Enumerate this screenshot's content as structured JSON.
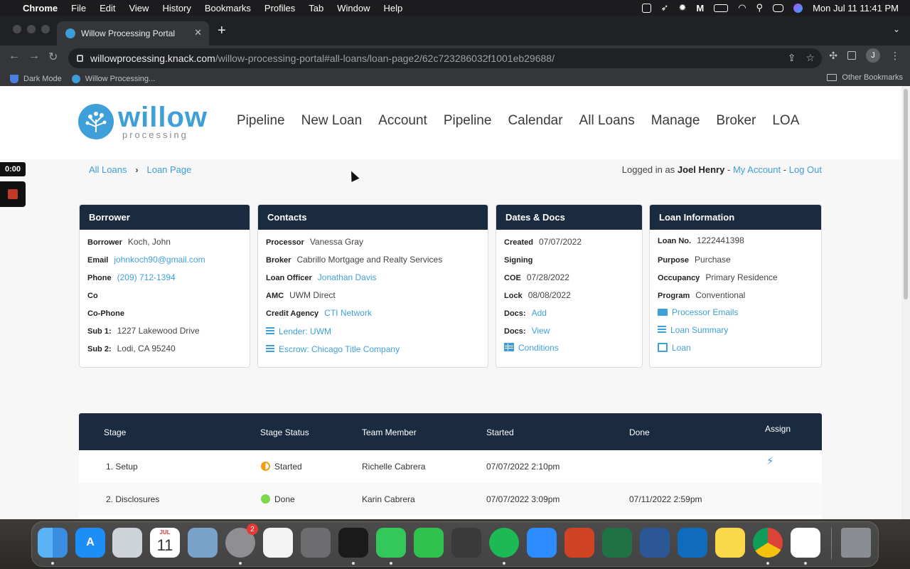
{
  "menubar": {
    "app": "Chrome",
    "items": [
      "File",
      "Edit",
      "View",
      "History",
      "Bookmarks",
      "Profiles",
      "Tab",
      "Window",
      "Help"
    ],
    "datetime": "Mon Jul 11  11:41 PM"
  },
  "browser": {
    "tab_title": "Willow Processing Portal",
    "url_host": "willowprocessing.knack.com",
    "url_path": "/willow-processing-portal#all-loans/loan-page2/62c723286032f1001eb29688/",
    "profile_initial": "J",
    "bookmarks": [
      "Dark Mode",
      "Willow Processing..."
    ],
    "other_bookmarks": "Other Bookmarks"
  },
  "recorder": {
    "time": "0:00"
  },
  "logo": {
    "word": "willow",
    "sub": "processing"
  },
  "nav": [
    "Pipeline",
    "New Loan",
    "Account",
    "Pipeline",
    "Calendar",
    "All Loans",
    "Manage",
    "Broker",
    "LOA"
  ],
  "breadcrumb": {
    "parent": "All Loans",
    "current": "Loan Page"
  },
  "session": {
    "prefix": "Logged in as",
    "user": "Joel Henry",
    "sep": "-",
    "my_account": "My Account",
    "logout": "Log Out"
  },
  "borrower": {
    "title": "Borrower",
    "rows": [
      {
        "label": "Borrower",
        "value": "Koch, John"
      },
      {
        "label": "Email",
        "value": "johnkoch90@gmail.com"
      },
      {
        "label": "Phone",
        "value": "(209) 712-1394"
      },
      {
        "label": "Co",
        "value": ""
      },
      {
        "label": "Co-Phone",
        "value": ""
      },
      {
        "label": "Sub 1:",
        "value": "1227 Lakewood Drive"
      },
      {
        "label": "Sub 2:",
        "value": "Lodi, CA 95240"
      }
    ]
  },
  "contacts": {
    "title": "Contacts",
    "rows": [
      {
        "label": "Processor",
        "value": "Vanessa Gray"
      },
      {
        "label": "Broker",
        "value": "Cabrillo Mortgage and Realty Services"
      },
      {
        "label": "Loan Officer",
        "value": "Jonathan Davis"
      },
      {
        "label": "AMC",
        "value": "UWM Direct"
      },
      {
        "label": "Credit Agency",
        "value": "CTI Network"
      }
    ],
    "links": [
      "Lender: UWM",
      "Escrow: Chicago Title Company"
    ]
  },
  "dates": {
    "title": "Dates & Docs",
    "rows": [
      {
        "label": "Created",
        "value": "07/07/2022"
      },
      {
        "label": "Signing",
        "value": ""
      },
      {
        "label": "COE",
        "value": "07/28/2022"
      },
      {
        "label": "Lock",
        "value": "08/08/2022"
      },
      {
        "label": "Docs:",
        "value": "Add"
      },
      {
        "label": "Docs:",
        "value": "View"
      }
    ],
    "conditions": "Conditions"
  },
  "loan": {
    "title": "Loan Information",
    "rows": [
      {
        "label": "Loan No.",
        "value": "1222441398"
      },
      {
        "label": "Purpose",
        "value": "Purchase"
      },
      {
        "label": "Occupancy",
        "value": "Primary Residence"
      },
      {
        "label": "Program",
        "value": "Conventional"
      }
    ],
    "links": [
      "Processor Emails",
      "Loan Summary",
      "Loan"
    ]
  },
  "stages": {
    "headers": [
      "Stage",
      "Stage Status",
      "Team Member",
      "Started",
      "Done",
      "Assign"
    ],
    "rows": [
      {
        "stage": "1. Setup",
        "status": "Started",
        "member": "Richelle Cabrera",
        "started": "07/07/2022 2:10pm",
        "done": ""
      },
      {
        "stage": "2. Disclosures",
        "status": "Done",
        "member": "Karin Cabrera",
        "started": "07/07/2022 3:09pm",
        "done": "07/11/2022 2:59pm"
      }
    ]
  },
  "dock": {
    "calendar_month": "JUL",
    "calendar_day": "11",
    "settings_badge": "2",
    "apps": [
      "finder-icon",
      "app-store-icon",
      "launchpad-icon",
      "calendar-icon",
      "preview-icon",
      "system-preferences-icon",
      "textedit-icon",
      "calculator-icon",
      "acrobat-icon",
      "messages-icon",
      "facetime-icon",
      "sublime-icon",
      "spotify-icon",
      "zoom-icon",
      "powerpoint-icon",
      "excel-icon",
      "word-icon",
      "outlook-icon",
      "notes-icon",
      "chrome-icon",
      "slack-icon",
      "trash-icon"
    ]
  }
}
